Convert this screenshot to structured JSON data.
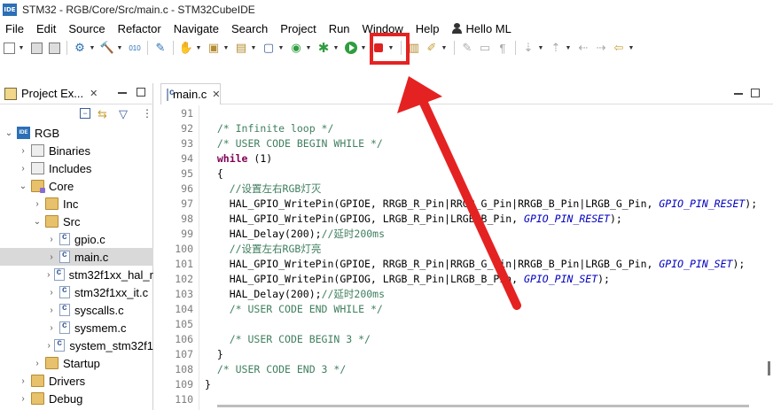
{
  "window": {
    "logo_text": "IDE",
    "title": "STM32 - RGB/Core/Src/main.c - STM32CubeIDE"
  },
  "menu": [
    "File",
    "Edit",
    "Source",
    "Refactor",
    "Navigate",
    "Search",
    "Project",
    "Run",
    "Window",
    "Help"
  ],
  "user": "Hello ML",
  "toolbar": {
    "highlighted_button": "debug-icon",
    "highlight_color": "#e52222",
    "icons": [
      "new-icon",
      "save-icon",
      "save-all-icon",
      "build-config-icon",
      "build-icon",
      "binary-icon",
      "device-icon",
      "hand-icon",
      "new-c-project-icon",
      "new-folder-icon",
      "new-c-file-icon",
      "new-class-icon",
      "debug-icon",
      "run-icon",
      "stop-icon",
      "open-perspective-icon",
      "tools-icon"
    ]
  },
  "project_explorer": {
    "tab_label": "Project Ex...",
    "tree": [
      {
        "label": "RGB",
        "icon": "project-icon",
        "expanded": true
      },
      {
        "label": "Binaries",
        "icon": "binaries-icon",
        "expanded": false
      },
      {
        "label": "Includes",
        "icon": "includes-icon",
        "expanded": false
      },
      {
        "label": "Core",
        "icon": "folder-icon",
        "expanded": true
      },
      {
        "label": "Inc",
        "icon": "folder-icon",
        "expanded": false
      },
      {
        "label": "Src",
        "icon": "folder-icon",
        "expanded": true
      },
      {
        "label": "gpio.c",
        "icon": "c-file-icon",
        "expanded": false
      },
      {
        "label": "main.c",
        "icon": "c-file-icon",
        "expanded": false,
        "selected": true
      },
      {
        "label": "stm32f1xx_hal_r",
        "icon": "c-file-icon",
        "expanded": false
      },
      {
        "label": "stm32f1xx_it.c",
        "icon": "c-file-icon",
        "expanded": false
      },
      {
        "label": "syscalls.c",
        "icon": "c-file-icon",
        "expanded": false
      },
      {
        "label": "sysmem.c",
        "icon": "c-file-icon",
        "expanded": false
      },
      {
        "label": "system_stm32f1",
        "icon": "c-file-icon",
        "expanded": false
      },
      {
        "label": "Startup",
        "icon": "folder-icon",
        "expanded": false
      },
      {
        "label": "Drivers",
        "icon": "folder-icon",
        "expanded": false
      },
      {
        "label": "Debug",
        "icon": "folder-icon",
        "expanded": false
      }
    ]
  },
  "editor": {
    "tab_label": "main.c",
    "lines": [
      {
        "n": "91",
        "segs": []
      },
      {
        "n": "92",
        "segs": [
          {
            "t": "  "
          },
          {
            "t": "/* Infinite loop */",
            "c": "cm"
          }
        ]
      },
      {
        "n": "93",
        "segs": [
          {
            "t": "  "
          },
          {
            "t": "/* USER CODE BEGIN WHILE */",
            "c": "cm"
          }
        ]
      },
      {
        "n": "94",
        "segs": [
          {
            "t": "  "
          },
          {
            "t": "while",
            "c": "kw"
          },
          {
            "t": " (1)"
          }
        ]
      },
      {
        "n": "95",
        "segs": [
          {
            "t": "  {"
          }
        ]
      },
      {
        "n": "96",
        "segs": [
          {
            "t": "    "
          },
          {
            "t": "//设置左右RGB灯灭",
            "c": "cm"
          }
        ]
      },
      {
        "n": "97",
        "segs": [
          {
            "t": "    HAL_GPIO_WritePin(GPIOE, RRGB_R_Pin|RRGB_G_Pin|RRGB_B_Pin|LRGB_G_Pin, "
          },
          {
            "t": "GPIO_PIN_RESET",
            "c": "cn"
          },
          {
            "t": ");"
          }
        ]
      },
      {
        "n": "98",
        "segs": [
          {
            "t": "    HAL_GPIO_WritePin(GPIOG, LRGB_R_Pin|LRGB_B_Pin, "
          },
          {
            "t": "GPIO_PIN_RESET",
            "c": "cn"
          },
          {
            "t": ");"
          }
        ]
      },
      {
        "n": "99",
        "segs": [
          {
            "t": "    HAL_Delay(200);"
          },
          {
            "t": "//延时200ms",
            "c": "cm"
          }
        ]
      },
      {
        "n": "100",
        "segs": [
          {
            "t": "    "
          },
          {
            "t": "//设置左右RGB灯亮",
            "c": "cm"
          }
        ]
      },
      {
        "n": "101",
        "segs": [
          {
            "t": "    HAL_GPIO_WritePin(GPIOE, RRGB_R_Pin|RRGB_G_Pin|RRGB_B_Pin|LRGB_G_Pin, "
          },
          {
            "t": "GPIO_PIN_SET",
            "c": "cn"
          },
          {
            "t": ");"
          }
        ]
      },
      {
        "n": "102",
        "segs": [
          {
            "t": "    HAL_GPIO_WritePin(GPIOG, LRGB_R_Pin|LRGB_B_Pin, "
          },
          {
            "t": "GPIO_PIN_SET",
            "c": "cn"
          },
          {
            "t": ");"
          }
        ]
      },
      {
        "n": "103",
        "segs": [
          {
            "t": "    HAL_Delay(200);"
          },
          {
            "t": "//延时200ms",
            "c": "cm"
          }
        ]
      },
      {
        "n": "104",
        "segs": [
          {
            "t": "    "
          },
          {
            "t": "/* USER CODE END WHILE */",
            "c": "cm"
          }
        ]
      },
      {
        "n": "105",
        "segs": []
      },
      {
        "n": "106",
        "segs": [
          {
            "t": "    "
          },
          {
            "t": "/* USER CODE BEGIN 3 */",
            "c": "cm"
          }
        ]
      },
      {
        "n": "107",
        "segs": [
          {
            "t": "  }"
          }
        ]
      },
      {
        "n": "108",
        "segs": [
          {
            "t": "  "
          },
          {
            "t": "/* USER CODE END 3 */",
            "c": "cm"
          }
        ]
      },
      {
        "n": "109",
        "segs": [
          {
            "t": "}"
          }
        ]
      },
      {
        "n": "110",
        "segs": []
      }
    ]
  },
  "annotation": {
    "arrow_color": "#e52222",
    "points_to": "debug-icon"
  }
}
